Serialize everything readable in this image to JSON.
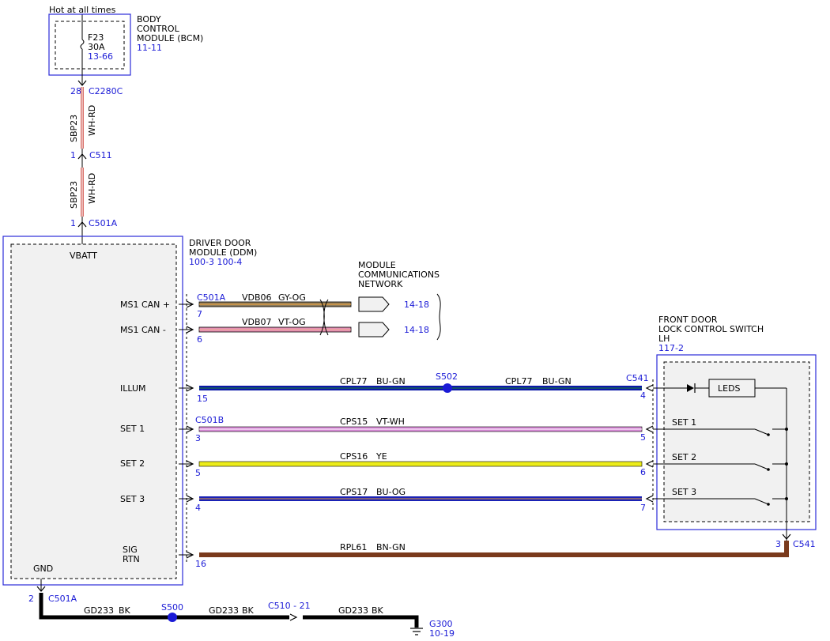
{
  "top": {
    "hot_label": "Hot at all times",
    "bcm_name": [
      "BODY",
      "CONTROL",
      "MODULE (BCM)"
    ],
    "bcm_page": "11-11",
    "fuse_name": "F23",
    "fuse_rating": "30A",
    "fuse_page": "13-66"
  },
  "feed": {
    "pin_28": "28",
    "conn_c2280c": "C2280C",
    "circuit_1": "SBP23",
    "color_1": "WH-RD",
    "pin_1a": "1",
    "conn_c511": "C511",
    "circuit_2": "SBP23",
    "color_2": "WH-RD",
    "pin_1b": "1",
    "conn_c501a": "C501A"
  },
  "ddm": {
    "name": [
      "DRIVER DOOR",
      "MODULE (DDM)"
    ],
    "pages": "100-3 100-4",
    "vbatt": "VBATT",
    "gnd": "GND",
    "pins": {
      "ms1_can_plus": "MS1 CAN +",
      "ms1_can_minus": "MS1 CAN -",
      "illum": "ILLUM",
      "set1": "SET 1",
      "set2": "SET 2",
      "set3": "SET 3",
      "sig": "SIG",
      "rtn": "RTN"
    }
  },
  "network": {
    "name": [
      "MODULE",
      "COMMUNICATIONS",
      "NETWORK"
    ],
    "conn": "C501A",
    "can_plus": {
      "pin": "7",
      "circuit": "VDB06",
      "color": "GY-OG",
      "page": "14-18"
    },
    "can_minus": {
      "pin": "6",
      "circuit": "VDB07",
      "color": "VT-OG",
      "page": "14-18"
    }
  },
  "switch": {
    "name": [
      "FRONT DOOR",
      "LOCK CONTROL SWITCH",
      "LH"
    ],
    "page": "117-2",
    "leds": "LEDS",
    "set1": "SET 1",
    "set2": "SET 2",
    "set3": "SET 3"
  },
  "wires": {
    "illum": {
      "ddm_pin": "15",
      "circuit_a": "CPL77",
      "color_a": "BU-GN",
      "splice": "S502",
      "circuit_b": "CPL77",
      "color_b": "BU-GN",
      "conn": "C541",
      "sw_pin": "4"
    },
    "set1": {
      "conn": "C501B",
      "ddm_pin": "3",
      "circuit": "CPS15",
      "color": "VT-WH",
      "sw_pin": "5"
    },
    "set2": {
      "ddm_pin": "5",
      "circuit": "CPS16",
      "color": "YE",
      "sw_pin": "6"
    },
    "set3": {
      "ddm_pin": "4",
      "circuit": "CPS17",
      "color": "BU-OG",
      "sw_pin": "7"
    },
    "sig_rtn": {
      "ddm_pin": "16",
      "circuit": "RPL61",
      "color": "BN-GN",
      "sw_pin": "3",
      "conn": "C541"
    }
  },
  "ground": {
    "pin": "2",
    "conn": "C501A",
    "circuit_1": "GD233",
    "color_1": "BK",
    "splice": "S500",
    "circuit_2": "GD233",
    "color_2": "BK",
    "inline_conn": "C510 - 21",
    "circuit_3": "GD233",
    "color_3": "BK",
    "ground_point": "G300",
    "ground_page": "10-19"
  },
  "colors": {
    "connector_label": "#1a1ad6",
    "module_border": "#2b2bd9",
    "wire_gy_og": "#8b7a5a",
    "wire_vt_og": "#e48fb4",
    "wire_bu_gn": "#0a16a8",
    "wire_vt_wh": "#d98ad8",
    "wire_ye": "#ecec1a",
    "wire_bu_og": "#1a22b5",
    "wire_bn_gn": "#7a3a1c",
    "wire_wh_rd": "#d9706a",
    "wire_bk": "#000000"
  }
}
